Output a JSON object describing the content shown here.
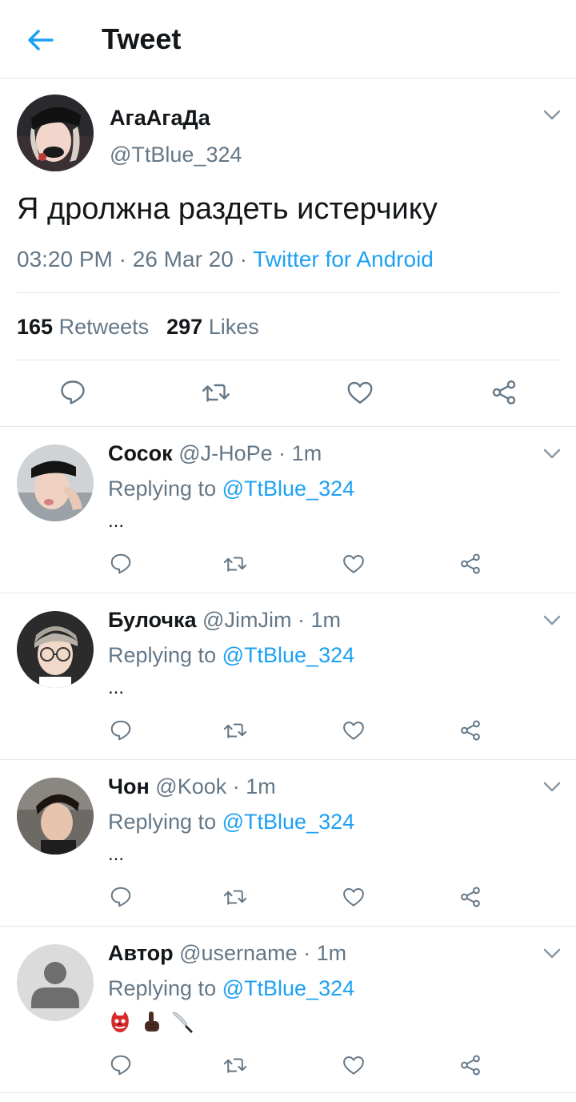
{
  "header": {
    "title": "Tweet",
    "back_icon": "arrow-left-icon",
    "accent": "#1da1f2"
  },
  "main_tweet": {
    "name": "АгаАгаДа",
    "handle": "@TtBlue_324",
    "text": "Я дролжна раздеть истерчику",
    "time": "03:20 PM",
    "date": "26 Mar 20",
    "sep": "·",
    "source": "Twitter for Android",
    "retweets_count": "165",
    "retweets_label": "Retweets",
    "likes_count": "297",
    "likes_label": "Likes"
  },
  "replies": [
    {
      "name": "Сосок",
      "handle": "@J-HoPe",
      "time": "1m",
      "replying_label": "Replying to",
      "mention": "@TtBlue_324",
      "text": "..."
    },
    {
      "name": "Булочка",
      "handle": "@JimJim",
      "time": "1m",
      "replying_label": "Replying to",
      "mention": "@TtBlue_324",
      "text": "..."
    },
    {
      "name": "Чон",
      "handle": "@Kook",
      "time": "1m",
      "replying_label": "Replying to",
      "mention": "@TtBlue_324",
      "text": "..."
    },
    {
      "name": "Автор",
      "handle": "@username",
      "time": "1m",
      "replying_label": "Replying to",
      "mention": "@TtBlue_324",
      "emojis": [
        "goblin-mask-emoji",
        "pointing-up-dark-emoji",
        "kitchen-knife-emoji"
      ]
    }
  ],
  "sep": "·",
  "colors": {
    "text": "#14171a",
    "secondary": "#657786",
    "link": "#1da1f2",
    "divider": "#e1e8ed"
  }
}
